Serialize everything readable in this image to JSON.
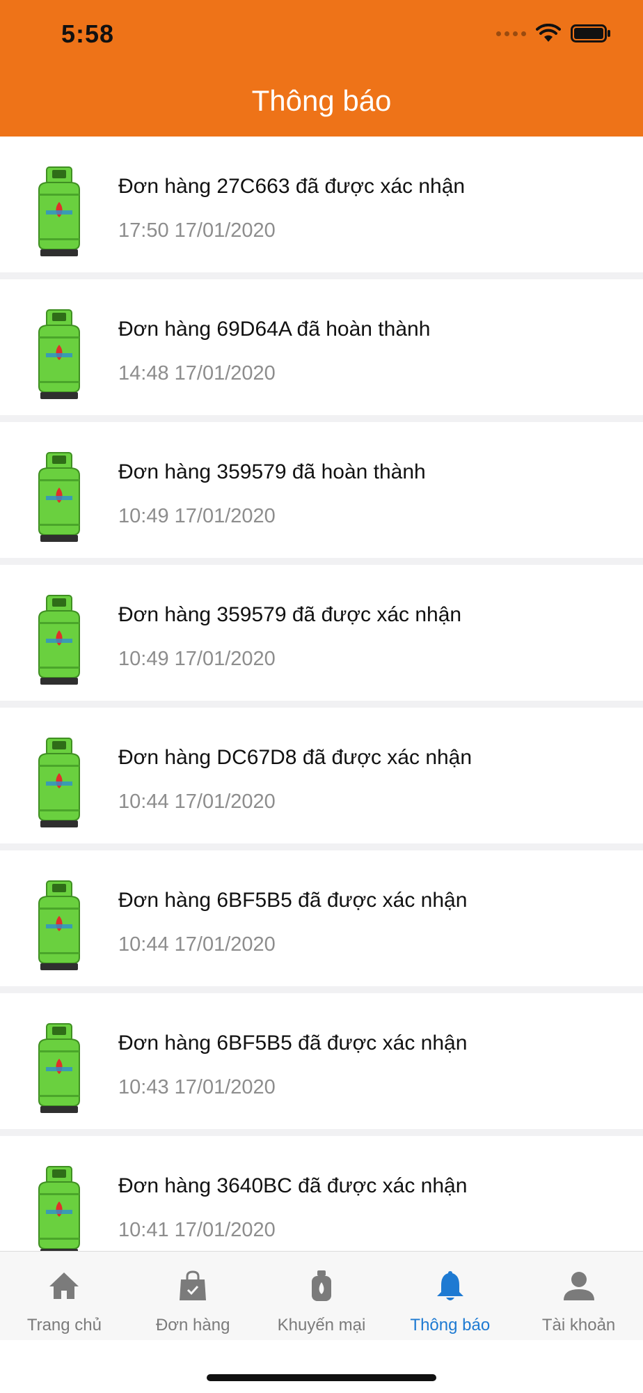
{
  "status_bar": {
    "time": "5:58"
  },
  "header": {
    "title": "Thông báo"
  },
  "notifications": [
    {
      "title": "Đơn hàng 27C663 đã được xác nhận",
      "time": "17:50 17/01/2020",
      "icon": "gas-cylinder-icon"
    },
    {
      "title": "Đơn hàng 69D64A đã hoàn thành",
      "time": "14:48 17/01/2020",
      "icon": "gas-cylinder-icon"
    },
    {
      "title": "Đơn hàng 359579 đã hoàn thành",
      "time": "10:49 17/01/2020",
      "icon": "gas-cylinder-icon"
    },
    {
      "title": "Đơn hàng 359579 đã được xác nhận",
      "time": "10:49 17/01/2020",
      "icon": "gas-cylinder-icon"
    },
    {
      "title": "Đơn hàng DC67D8 đã được xác nhận",
      "time": "10:44 17/01/2020",
      "icon": "gas-cylinder-icon"
    },
    {
      "title": "Đơn hàng 6BF5B5 đã được xác nhận",
      "time": "10:44 17/01/2020",
      "icon": "gas-cylinder-icon"
    },
    {
      "title": "Đơn hàng 6BF5B5 đã được xác nhận",
      "time": "10:43 17/01/2020",
      "icon": "gas-cylinder-icon"
    },
    {
      "title": "Đơn hàng 3640BC đã được xác nhận",
      "time": "10:41 17/01/2020",
      "icon": "gas-cylinder-icon"
    }
  ],
  "tabs": [
    {
      "label": "Trang chủ",
      "icon": "home-icon",
      "active": false
    },
    {
      "label": "Đơn hàng",
      "icon": "shopping-bag-icon",
      "active": false
    },
    {
      "label": "Khuyến mại",
      "icon": "gas-promo-icon",
      "active": false
    },
    {
      "label": "Thông báo",
      "icon": "bell-icon",
      "active": true
    },
    {
      "label": "Tài khoản",
      "icon": "user-icon",
      "active": false
    }
  ],
  "colors": {
    "header_bg": "#ee7318",
    "tab_active": "#1e7ad2",
    "tab_inactive": "#7b7b7b",
    "cylinder_green": "#6ad03f"
  }
}
